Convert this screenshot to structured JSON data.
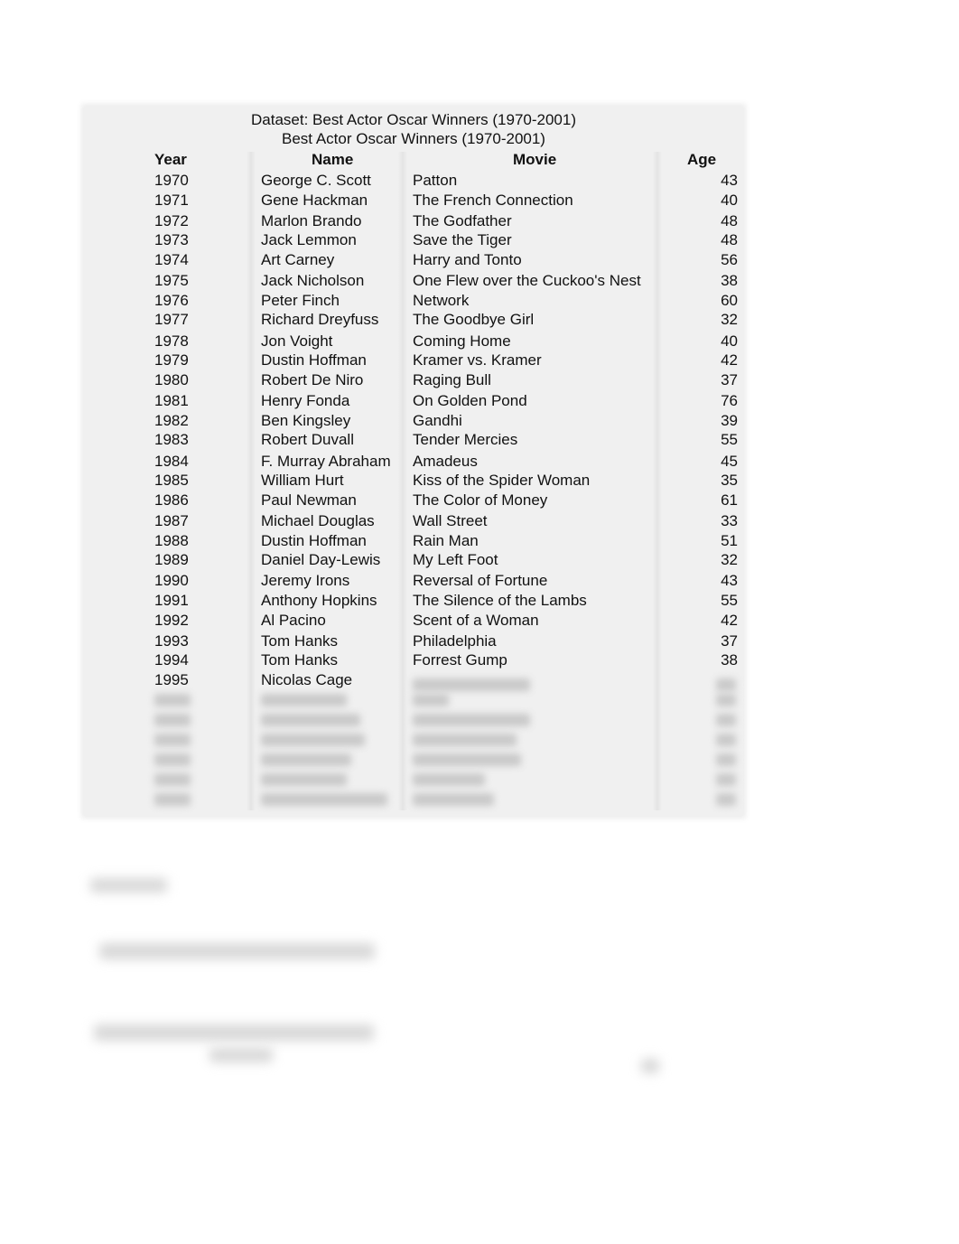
{
  "document": {
    "dataset_title": "Dataset: Best Actor Oscar Winners (1970-2001)",
    "table_title": "Best Actor Oscar Winners (1970-2001)",
    "columns": [
      "Year",
      "Name",
      "Movie",
      "Age"
    ],
    "rows": [
      {
        "year": "1970",
        "name": "George C. Scott",
        "movie": "Patton",
        "age": "43"
      },
      {
        "year": "1971",
        "name": "Gene Hackman",
        "movie": "The French Connection",
        "age": "40"
      },
      {
        "year": "1972",
        "name": "Marlon Brando",
        "movie": "The Godfather",
        "age": "48"
      },
      {
        "year": "1973",
        "name": "Jack Lemmon",
        "movie": "Save the Tiger",
        "age": "48"
      },
      {
        "year": "1974",
        "name": "Art Carney",
        "movie": "Harry and Tonto",
        "age": "56"
      },
      {
        "year": "1975",
        "name": "Jack Nicholson",
        "movie": "One Flew over the Cuckoo's Nest",
        "age": "38"
      },
      {
        "year": "1976",
        "name": "Peter Finch",
        "movie": "Network",
        "age": "60"
      },
      {
        "year": "1977",
        "name": "Richard Dreyfuss",
        "movie": "The Goodbye Girl",
        "age": "32"
      },
      {
        "year": "1978",
        "name": "Jon Voight",
        "movie": "Coming Home",
        "age": "40"
      },
      {
        "year": "1979",
        "name": "Dustin Hoffman",
        "movie": "Kramer vs. Kramer",
        "age": "42"
      },
      {
        "year": "1980",
        "name": "Robert De Niro",
        "movie": "Raging Bull",
        "age": "37"
      },
      {
        "year": "1981",
        "name": "Henry Fonda",
        "movie": "On Golden Pond",
        "age": "76"
      },
      {
        "year": "1982",
        "name": "Ben Kingsley",
        "movie": "Gandhi",
        "age": "39"
      },
      {
        "year": "1983",
        "name": "Robert Duvall",
        "movie": "Tender Mercies",
        "age": "55"
      },
      {
        "year": "1984",
        "name": "F. Murray Abraham",
        "movie": "Amadeus",
        "age": "45"
      },
      {
        "year": "1985",
        "name": "William Hurt",
        "movie": "Kiss of the Spider Woman",
        "age": "35"
      },
      {
        "year": "1986",
        "name": "Paul Newman",
        "movie": "The Color of Money",
        "age": "61"
      },
      {
        "year": "1987",
        "name": "Michael Douglas",
        "movie": "Wall Street",
        "age": "33"
      },
      {
        "year": "1988",
        "name": "Dustin Hoffman",
        "movie": "Rain Man",
        "age": "51"
      },
      {
        "year": "1989",
        "name": "Daniel Day-Lewis",
        "movie": "My Left Foot",
        "age": "32"
      },
      {
        "year": "1990",
        "name": "Jeremy Irons",
        "movie": "Reversal of Fortune",
        "age": "43"
      },
      {
        "year": "1991",
        "name": "Anthony Hopkins",
        "movie": "The Silence of the Lambs",
        "age": "55"
      },
      {
        "year": "1992",
        "name": "Al Pacino",
        "movie": "Scent of a Woman",
        "age": "42"
      },
      {
        "year": "1993",
        "name": "Tom Hanks",
        "movie": "Philadelphia",
        "age": "37"
      },
      {
        "year": "1994",
        "name": "Tom Hanks",
        "movie": "Forrest Gump",
        "age": "38"
      },
      {
        "year": "1995",
        "name": "Nicolas Cage",
        "movie": "",
        "age": ""
      }
    ],
    "blurred_rows_count": 6
  }
}
